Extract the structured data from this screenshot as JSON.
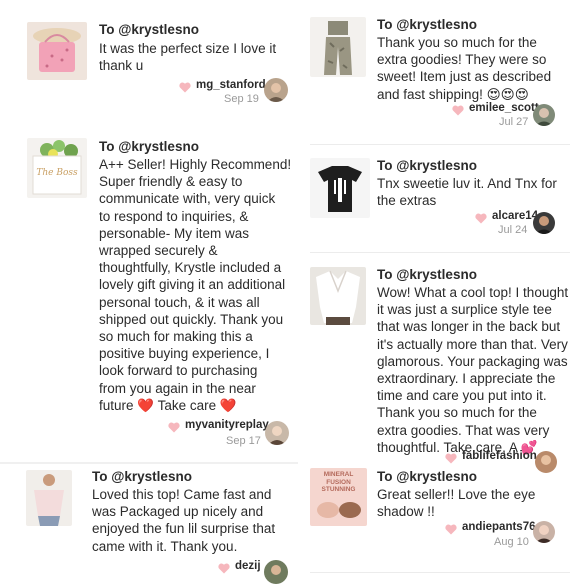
{
  "reviews": [
    {
      "to": "To @krystlesno",
      "lines": [
        "It was the perfect size I love it",
        "thank u"
      ],
      "user": "mg_stanford",
      "date": "Sep 19",
      "thumb_icon": "pink-bag-thumbnail"
    },
    {
      "to": "To @krystlesno",
      "lines": [
        "Thank you so much for the",
        "extra goodies! They were so",
        "sweet! Item just as described",
        "and fast shipping! 😍😍😍"
      ],
      "user": "emilee_scott",
      "date": "Jul 27",
      "thumb_icon": "camo-outfit-thumbnail"
    },
    {
      "to": "To @krystlesno",
      "lines": [
        "A++ Seller! Highly Recommend!",
        "Super friendly & easy to",
        "communicate with, very quick",
        "to respond to inquiries, &",
        "personable- My item was",
        "wrapped securely &",
        "thoughtfully, Krystle included a",
        "lovely gift giving it an additional",
        "personal touch, & it was all",
        "shipped out quickly. Thank you",
        "so much for making this a",
        "positive buying experience, I",
        "look forward to purchasing",
        "from you again in the near",
        "future ❤️ Take care ❤️"
      ],
      "user": "myvanityreplay",
      "date": "Sep 17",
      "thumb_icon": "the-boss-box-thumbnail",
      "thumb_text": "The Boss"
    },
    {
      "to": "To @krystlesno",
      "lines": [
        "Tnx sweetie luv it. And Tnx for",
        "the extras"
      ],
      "user": "alcare14",
      "date": "Jul 24",
      "thumb_icon": "black-tee-thumbnail"
    },
    {
      "to": "To @krystlesno",
      "lines": [
        "Wow! What a cool top! I thought",
        "it was just a surplice style tee",
        "that was longer in the back but",
        "it's actually more than that. Very",
        "glamorous. Your packaging was",
        "extraordinary. I appreciate the",
        "time and care you put into it.",
        "Thank you so much for the",
        "extra goodies. That was very",
        "thoughtful. Take care, A 💕"
      ],
      "user": "fablifefashion",
      "date": "",
      "thumb_icon": "white-top-thumbnail"
    },
    {
      "to": "To @krystlesno",
      "lines": [
        "Loved this top! Came fast and",
        "was Packaged up nicely and",
        "enjoyed the fun lil surprise that",
        "came with it. Thank you."
      ],
      "user": "dezij",
      "date": "",
      "thumb_icon": "off-shoulder-top-thumbnail"
    },
    {
      "to": "To @krystlesno",
      "lines": [
        "Great seller!! Love the eye",
        "shadow !!"
      ],
      "user": "andiepants76",
      "date": "Aug 10",
      "thumb_icon": "eyeshadow-palette-thumbnail",
      "thumb_text": "MINERAL FUSION STUNNING"
    }
  ],
  "colors": {
    "text": "#2b2b2b",
    "date": "#9a9a9a",
    "heart": "#f6b7bd"
  }
}
